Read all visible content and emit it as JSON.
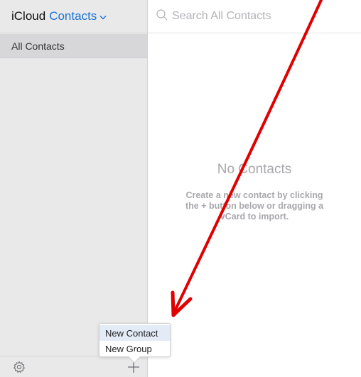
{
  "header": {
    "app_name": "iCloud",
    "section": "Contacts"
  },
  "sidebar": {
    "groups": [
      {
        "label": "All Contacts"
      }
    ]
  },
  "search": {
    "placeholder": "Search All Contacts"
  },
  "empty_state": {
    "title": "No Contacts",
    "body": "Create a new contact by clicking the + button below or dragging a vCard to import."
  },
  "popover": {
    "items": [
      {
        "label": "New Contact"
      },
      {
        "label": "New Group"
      }
    ]
  },
  "icons": {
    "search": "search-icon",
    "gear": "gear-icon",
    "plus": "plus-icon",
    "chevron": "chevron-down-icon"
  },
  "colors": {
    "accent": "#1a73d6",
    "annotation": "#e00000"
  }
}
